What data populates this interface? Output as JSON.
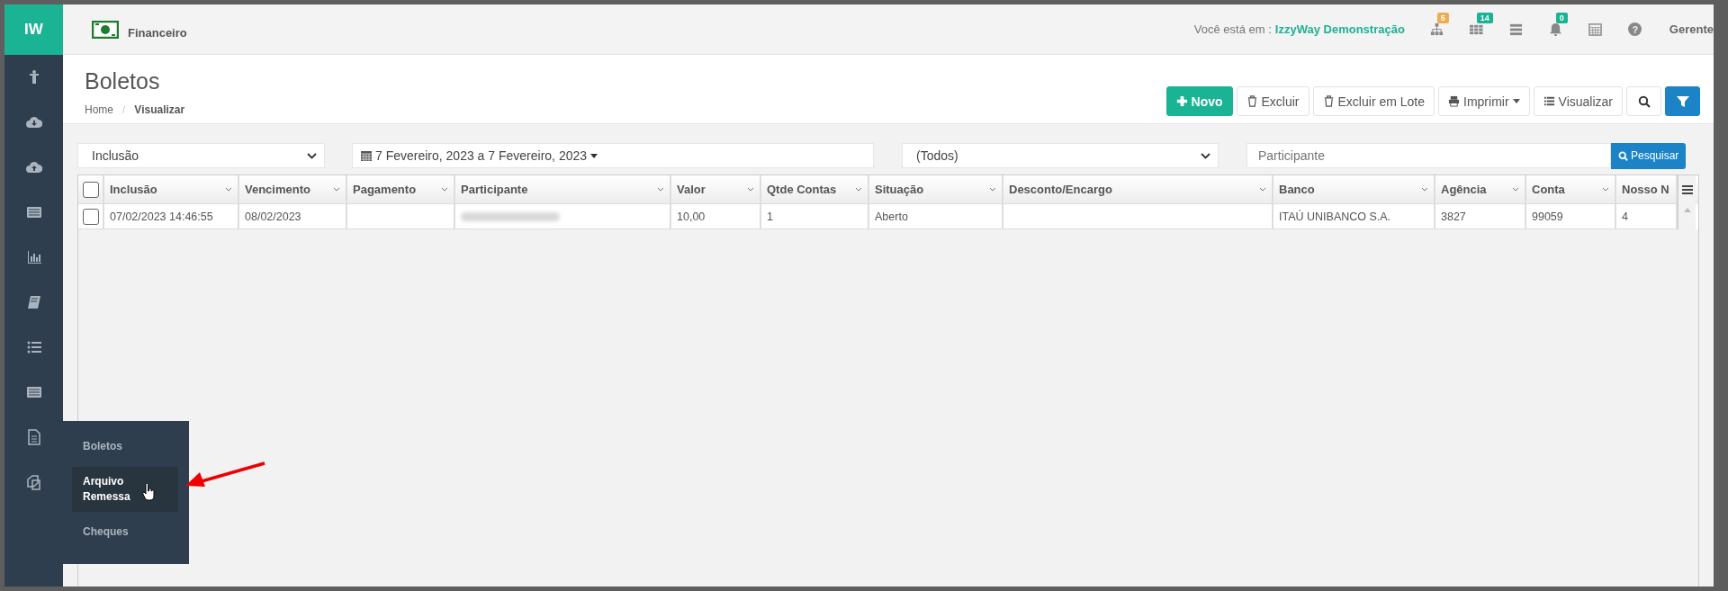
{
  "logo": {
    "text": "IW"
  },
  "module": {
    "title": "Financeiro"
  },
  "topbar": {
    "location_label": "Você está em :",
    "location": "IzzyWay Demonstração",
    "user": "Gerente",
    "badges": [
      {
        "badge": "5",
        "color": "#f0ad4e"
      },
      {
        "badge": "14",
        "color": "#1ab394"
      },
      {
        "badge": "0",
        "color": "#1ab394"
      }
    ]
  },
  "help": {
    "glyph": "?"
  },
  "page": {
    "title": "Boletos",
    "separator": "/",
    "breadcrumbs": [
      {
        "label": "Home",
        "selected": false
      },
      {
        "label": "Visualizar",
        "selected": true
      }
    ]
  },
  "toolbar": [
    {
      "label": "Novo",
      "kind": "success",
      "dropdown": false
    },
    {
      "label": "Excluir",
      "kind": "default",
      "dropdown": false
    },
    {
      "label": "Excluir em Lote",
      "kind": "default",
      "dropdown": false
    },
    {
      "label": "Imprimir",
      "kind": "default",
      "dropdown": true
    },
    {
      "label": "Visualizar",
      "kind": "default",
      "dropdown": false
    }
  ],
  "filters": {
    "date_field": "Inclusão",
    "date_range": "7 Fevereiro, 2023 a 7 Fevereiro, 2023",
    "status": "(Todos)",
    "search_placeholder": "Participante",
    "search_button": "Pesquisar"
  },
  "table": {
    "header_checked": false,
    "columns": [
      "Inclusão",
      "Vencimento",
      "Pagamento",
      "Participante",
      "Valor",
      "Qtde Contas",
      "Situação",
      "Desconto/Encargo",
      "Banco",
      "Agência",
      "Conta",
      "Nosso N"
    ],
    "rows": [
      {
        "checked": false,
        "cells": [
          "07/02/2023 14:46:55",
          "08/02/2023",
          null,
          {
            "redacted": true
          },
          "10,00",
          "1",
          "Aberto",
          null,
          "ITAÚ UNIBANCO S.A.",
          "3827",
          "99059",
          "4"
        ]
      }
    ]
  },
  "flyout_menu": [
    {
      "label": "Boletos",
      "selected": false
    },
    {
      "label": "Arquivo Remessa",
      "selected": true
    },
    {
      "label": "Cheques",
      "selected": false
    }
  ]
}
